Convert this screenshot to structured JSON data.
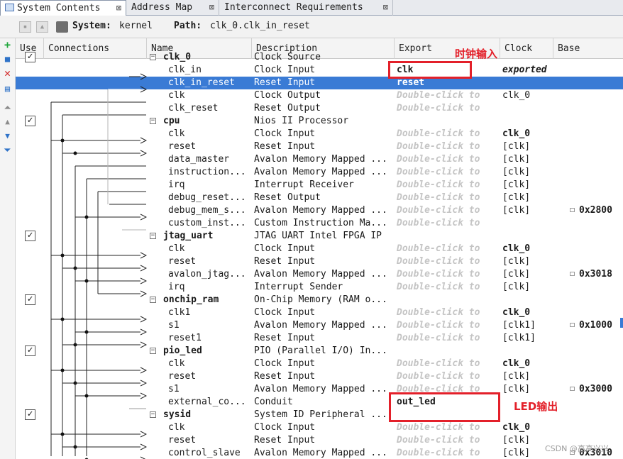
{
  "tabs": [
    {
      "label": "System Contents",
      "close": "⊠"
    },
    {
      "label": "Address Map",
      "close": "⊠"
    },
    {
      "label": "Interconnect Requirements",
      "close": "⊠"
    }
  ],
  "pathbar": {
    "system_label": "System:",
    "system_value": "kernel",
    "path_label": "Path:",
    "path_value": "clk_0.clk_in_reset"
  },
  "columns": {
    "use": "Use",
    "connections": "Connections",
    "name": "Name",
    "description": "Description",
    "export": "Export",
    "clock": "Clock",
    "base": "Base"
  },
  "rows": [
    {
      "type": "comp",
      "name": "clk_0",
      "desc": "Clock Source",
      "export": "",
      "clock": "",
      "base": "",
      "check": true
    },
    {
      "type": "port",
      "name": "clk_in",
      "desc": "Clock Input",
      "export": "clk",
      "clock": "exported",
      "base": ""
    },
    {
      "type": "port",
      "name": "clk_in_reset",
      "desc": "Reset Input",
      "export": "reset",
      "clock": "",
      "base": "",
      "selected": true
    },
    {
      "type": "port",
      "name": "clk",
      "desc": "Clock Output",
      "export": "Double-click to",
      "clock": "clk_0",
      "base": ""
    },
    {
      "type": "port",
      "name": "clk_reset",
      "desc": "Reset Output",
      "export": "Double-click to",
      "clock": "",
      "base": ""
    },
    {
      "type": "comp",
      "name": "cpu",
      "desc": "Nios II Processor",
      "export": "",
      "clock": "",
      "base": "",
      "check": true
    },
    {
      "type": "port",
      "name": "clk",
      "desc": "Clock Input",
      "export": "Double-click to",
      "clock": "clk_0",
      "base": ""
    },
    {
      "type": "port",
      "name": "reset",
      "desc": "Reset Input",
      "export": "Double-click to",
      "clock": "[clk]",
      "base": ""
    },
    {
      "type": "port",
      "name": "data_master",
      "desc": "Avalon Memory Mapped ...",
      "export": "Double-click to",
      "clock": "[clk]",
      "base": ""
    },
    {
      "type": "port",
      "name": "instruction...",
      "desc": "Avalon Memory Mapped ...",
      "export": "Double-click to",
      "clock": "[clk]",
      "base": ""
    },
    {
      "type": "port",
      "name": "irq",
      "desc": "Interrupt Receiver",
      "export": "Double-click to",
      "clock": "[clk]",
      "base": ""
    },
    {
      "type": "port",
      "name": "debug_reset...",
      "desc": "Reset Output",
      "export": "Double-click to",
      "clock": "[clk]",
      "base": ""
    },
    {
      "type": "port",
      "name": "debug_mem_s...",
      "desc": "Avalon Memory Mapped ...",
      "export": "Double-click to",
      "clock": "[clk]",
      "base": "0x2800"
    },
    {
      "type": "port",
      "name": "custom_inst...",
      "desc": "Custom Instruction Ma...",
      "export": "Double-click to",
      "clock": "",
      "base": ""
    },
    {
      "type": "comp",
      "name": "jtag_uart",
      "desc": "JTAG UART Intel FPGA IP",
      "export": "",
      "clock": "",
      "base": "",
      "check": true
    },
    {
      "type": "port",
      "name": "clk",
      "desc": "Clock Input",
      "export": "Double-click to",
      "clock": "clk_0",
      "base": ""
    },
    {
      "type": "port",
      "name": "reset",
      "desc": "Reset Input",
      "export": "Double-click to",
      "clock": "[clk]",
      "base": ""
    },
    {
      "type": "port",
      "name": "avalon_jtag...",
      "desc": "Avalon Memory Mapped ...",
      "export": "Double-click to",
      "clock": "[clk]",
      "base": "0x3018"
    },
    {
      "type": "port",
      "name": "irq",
      "desc": "Interrupt Sender",
      "export": "Double-click to",
      "clock": "[clk]",
      "base": ""
    },
    {
      "type": "comp",
      "name": "onchip_ram",
      "desc": "On-Chip Memory (RAM o...",
      "export": "",
      "clock": "",
      "base": "",
      "check": true
    },
    {
      "type": "port",
      "name": "clk1",
      "desc": "Clock Input",
      "export": "Double-click to",
      "clock": "clk_0",
      "base": ""
    },
    {
      "type": "port",
      "name": "s1",
      "desc": "Avalon Memory Mapped ...",
      "export": "Double-click to",
      "clock": "[clk1]",
      "base": "0x1000"
    },
    {
      "type": "port",
      "name": "reset1",
      "desc": "Reset Input",
      "export": "Double-click to",
      "clock": "[clk1]",
      "base": ""
    },
    {
      "type": "comp",
      "name": "pio_led",
      "desc": "PIO (Parallel I/O) In...",
      "export": "",
      "clock": "",
      "base": "",
      "check": true
    },
    {
      "type": "port",
      "name": "clk",
      "desc": "Clock Input",
      "export": "Double-click to",
      "clock": "clk_0",
      "base": ""
    },
    {
      "type": "port",
      "name": "reset",
      "desc": "Reset Input",
      "export": "Double-click to",
      "clock": "[clk]",
      "base": ""
    },
    {
      "type": "port",
      "name": "s1",
      "desc": "Avalon Memory Mapped ...",
      "export": "Double-click to",
      "clock": "[clk]",
      "base": "0x3000"
    },
    {
      "type": "port",
      "name": "external_co...",
      "desc": "Conduit",
      "export": "out_led",
      "clock": "",
      "base": ""
    },
    {
      "type": "comp",
      "name": "sysid",
      "desc": "System ID Peripheral ...",
      "export": "",
      "clock": "",
      "base": "",
      "check": true
    },
    {
      "type": "port",
      "name": "clk",
      "desc": "Clock Input",
      "export": "Double-click to",
      "clock": "clk_0",
      "base": ""
    },
    {
      "type": "port",
      "name": "reset",
      "desc": "Reset Input",
      "export": "Double-click to",
      "clock": "[clk]",
      "base": ""
    },
    {
      "type": "port",
      "name": "control_slave",
      "desc": "Avalon Memory Mapped ...",
      "export": "Double-click to",
      "clock": "[clk]",
      "base": "0x3010"
    }
  ],
  "annotations": {
    "clock_input": "时钟输入",
    "led_output": "LED输出"
  },
  "watermark": "CSDN @高高兴兴",
  "colors": {
    "selection": "#3a7bd5",
    "annotation_red": "#e3202a",
    "placeholder_gray": "#c4c4c4"
  },
  "icons": [
    "system-contents-icon",
    "close-tab-icon",
    "add-icon",
    "remove-icon",
    "move-up-icon",
    "move-down-icon",
    "expand-icon",
    "lock-icon"
  ]
}
